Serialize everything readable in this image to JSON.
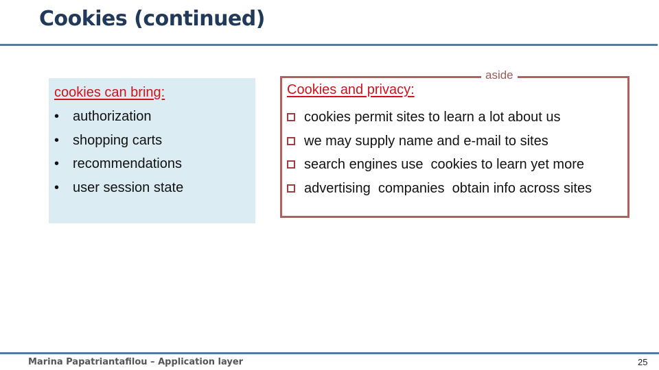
{
  "slide": {
    "title": "Cookies (continued)",
    "colors": {
      "title": "#213a5a",
      "rule": "#557a9c",
      "heading_red": "#d0121b",
      "left_box_bg": "#dbecf3",
      "aside_border": "#b06060"
    }
  },
  "left_box": {
    "heading": "cookies can bring:",
    "bullet_glyph": "•",
    "items": [
      "authorization",
      "shopping carts",
      "recommendations",
      "user session state"
    ]
  },
  "aside_box": {
    "label": "aside",
    "heading": "Cookies and privacy:",
    "items": [
      "cookies permit sites to learn a lot about us",
      "we may supply name and e-mail to sites",
      "search engines use  cookies to learn yet more",
      "advertising  companies  obtain info across sites"
    ]
  },
  "footer": {
    "author": "Marina Papatriantafilou –  Application layer",
    "page_number": "25"
  }
}
